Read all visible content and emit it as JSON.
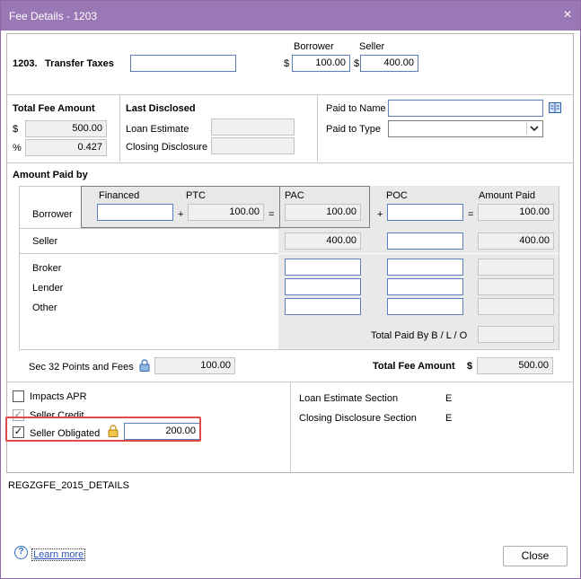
{
  "window": {
    "title": "Fee Details - 1203",
    "close_icon": "×"
  },
  "line": {
    "number": "1203.",
    "name": "Transfer Taxes",
    "description_value": ""
  },
  "header_cols": {
    "borrower": "Borrower",
    "seller": "Seller",
    "currency": "$"
  },
  "top_amounts": {
    "borrower": "100.00",
    "seller": "400.00"
  },
  "total_fee": {
    "title": "Total Fee Amount",
    "dollar_symbol": "$",
    "dollar_value": "500.00",
    "percent_symbol": "%",
    "percent_value": "0.427"
  },
  "last_disclosed": {
    "title": "Last Disclosed",
    "loan_estimate_label": "Loan Estimate",
    "loan_estimate_value": "",
    "closing_disclosure_label": "Closing Disclosure",
    "closing_disclosure_value": ""
  },
  "paid_to": {
    "name_label": "Paid to Name",
    "name_value": "",
    "type_label": "Paid to Type",
    "type_value": ""
  },
  "amount_paid_by": {
    "title": "Amount Paid by",
    "col_financed": "Financed",
    "col_ptc": "PTC",
    "col_pac": "PAC",
    "col_poc": "POC",
    "col_amount_paid": "Amount Paid",
    "plus": "+",
    "equals": "=",
    "borrower": {
      "label": "Borrower",
      "financed": "",
      "ptc": "100.00",
      "pac": "100.00",
      "poc": "",
      "amount_paid": "100.00"
    },
    "seller": {
      "label": "Seller",
      "pac": "400.00",
      "poc": "",
      "amount_paid": "400.00"
    },
    "broker": {
      "label": "Broker",
      "pac": "",
      "poc": "",
      "amount_paid": ""
    },
    "lender": {
      "label": "Lender",
      "pac": "",
      "poc": "",
      "amount_paid": ""
    },
    "other": {
      "label": "Other",
      "pac": "",
      "poc": "",
      "amount_paid": ""
    },
    "total_paid_label": "Total Paid By B / L / O",
    "total_paid_value": ""
  },
  "sec32": {
    "label": "Sec 32 Points and Fees",
    "value": "100.00"
  },
  "total_fee_amount": {
    "label": "Total Fee Amount",
    "symbol": "$",
    "value": "500.00"
  },
  "options": {
    "impacts_apr": {
      "label": "Impacts APR",
      "checked": false
    },
    "seller_credit": {
      "label": "Seller Credit",
      "checked": true
    },
    "seller_obligated": {
      "label": "Seller Obligated",
      "checked": true,
      "value": "200.00"
    }
  },
  "sections": {
    "loan_estimate_label": "Loan Estimate Section",
    "loan_estimate_value": "E",
    "closing_disclosure_label": "Closing Disclosure Section",
    "closing_disclosure_value": "E"
  },
  "form_id": "REGZGFE_2015_DETAILS",
  "footer": {
    "learn_more": "Learn more",
    "close_button": "Close",
    "help_icon": "?"
  },
  "colors": {
    "titlebar": "#9a77b5",
    "highlight": "#e04a4a",
    "field_border": "#5a7fbf"
  }
}
